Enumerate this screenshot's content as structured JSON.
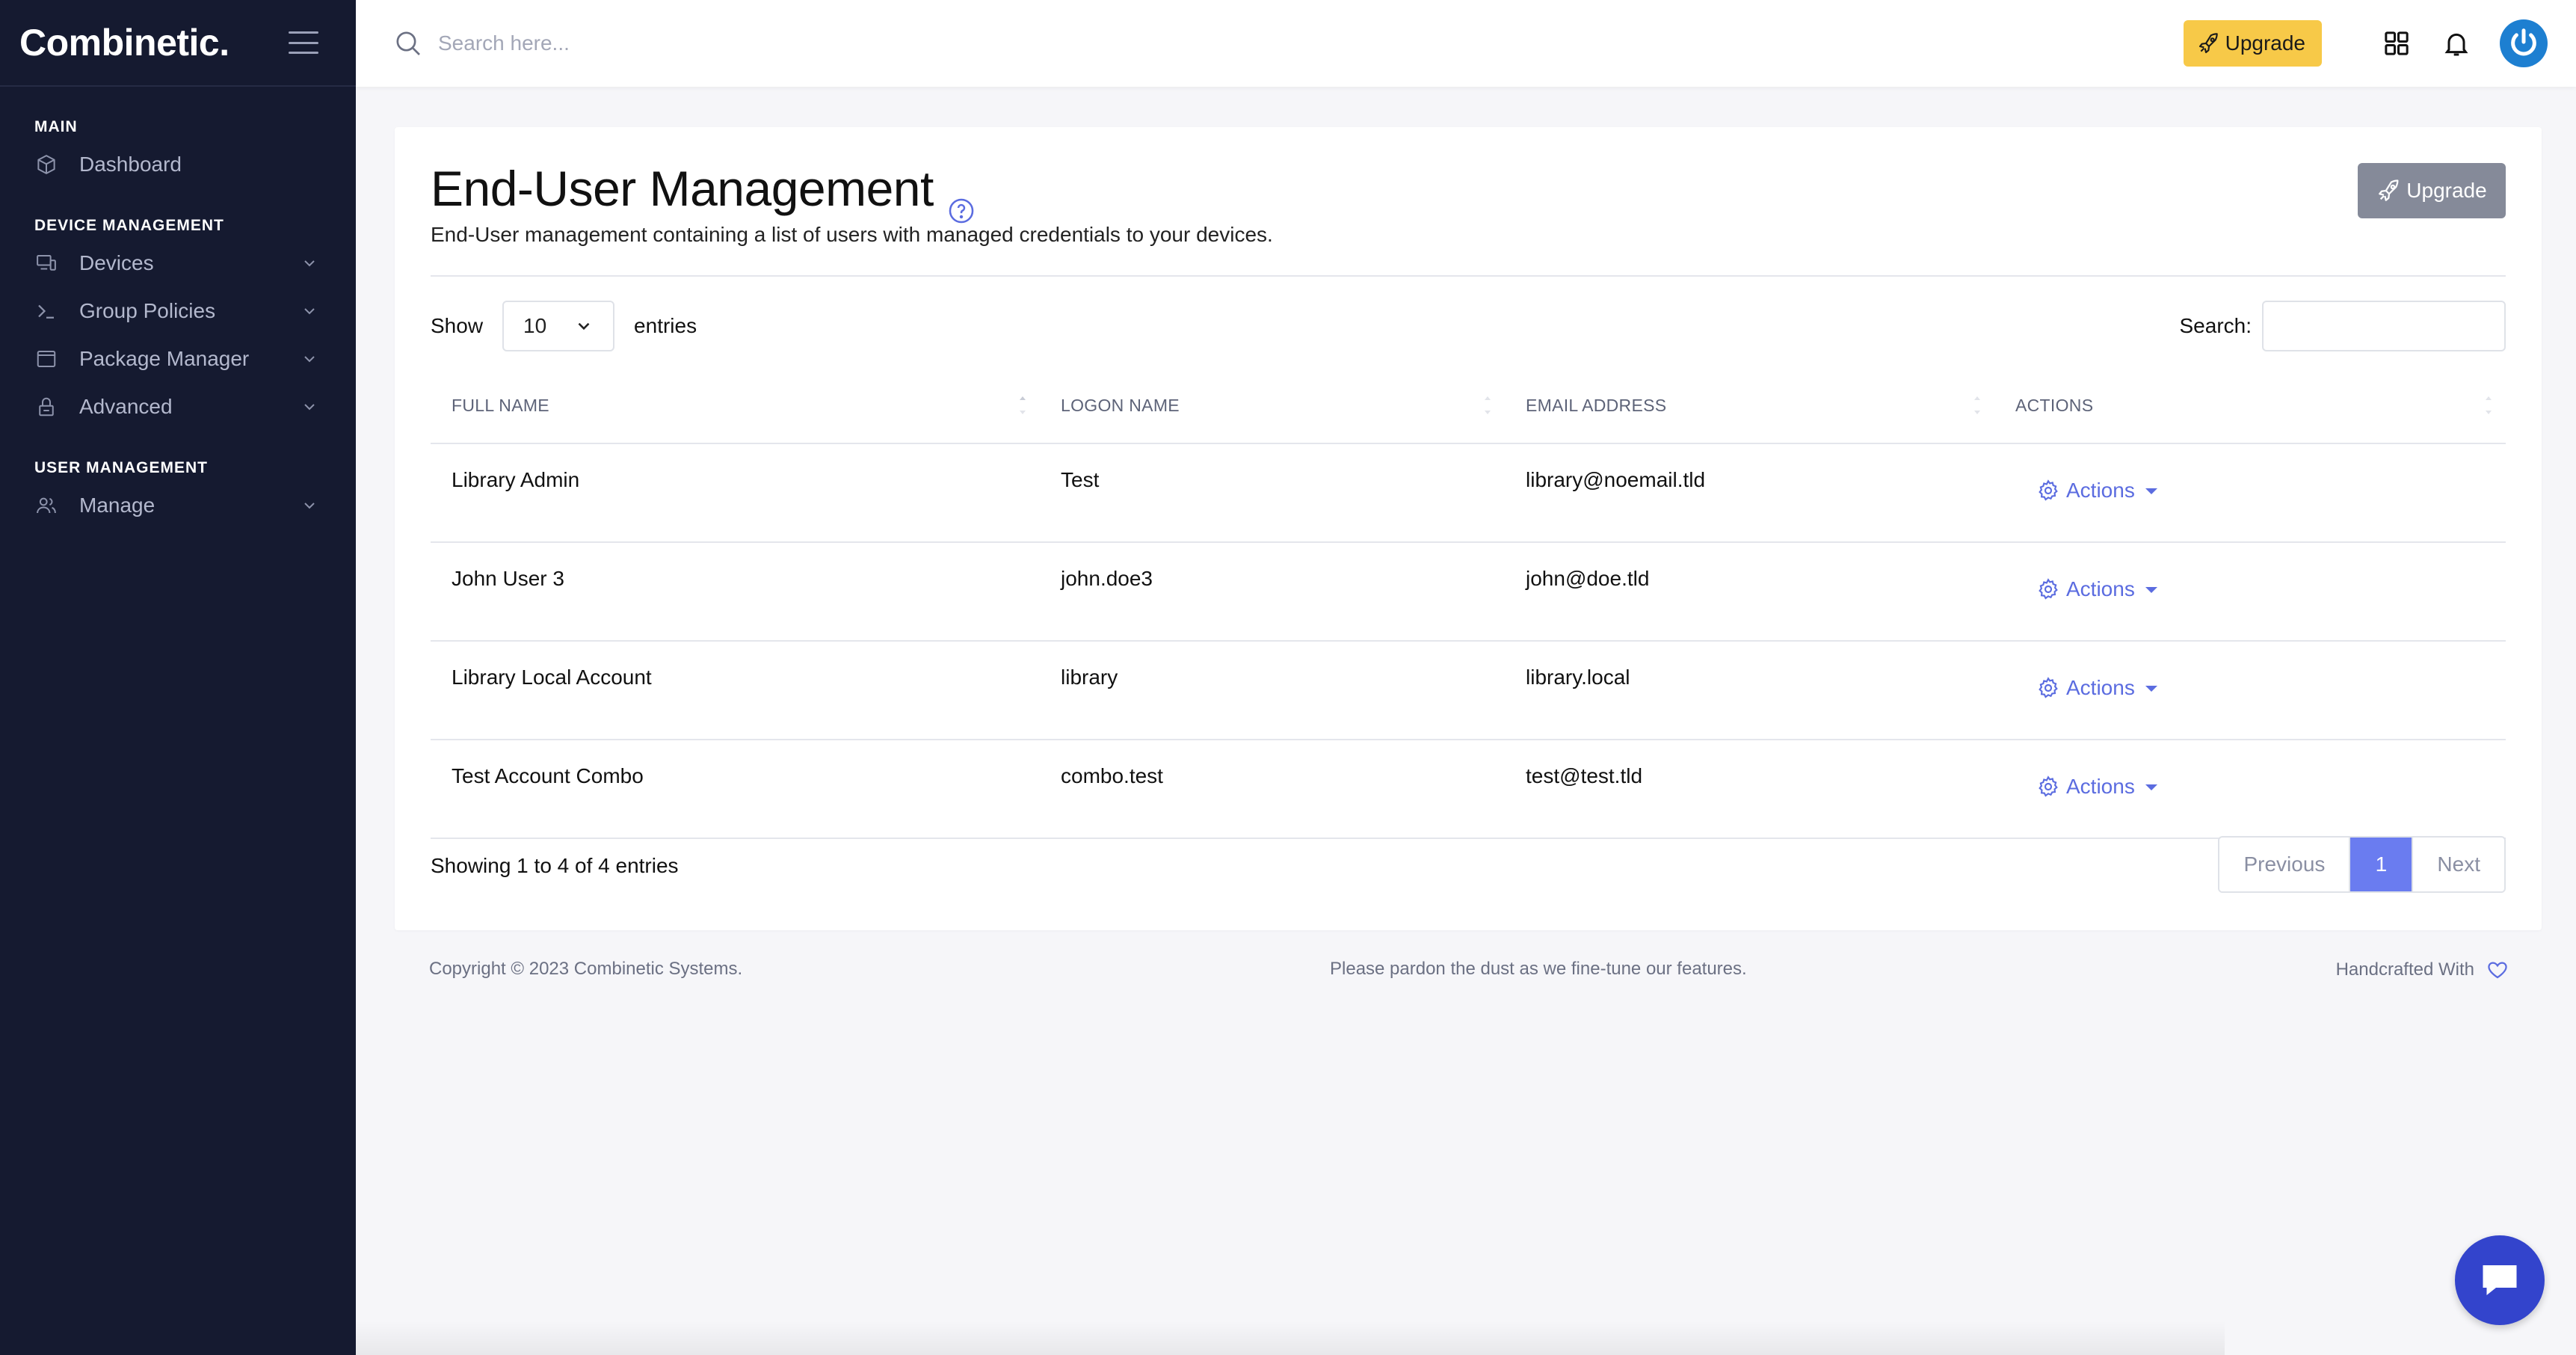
{
  "brand": {
    "name": "Combinetic."
  },
  "sidebar": {
    "sections": [
      {
        "title": "MAIN",
        "items": [
          {
            "label": "Dashboard",
            "icon": "cube-icon",
            "has_submenu": false
          }
        ]
      },
      {
        "title": "DEVICE MANAGEMENT",
        "items": [
          {
            "label": "Devices",
            "icon": "devices-icon",
            "has_submenu": true
          },
          {
            "label": "Group Policies",
            "icon": "terminal-icon",
            "has_submenu": true
          },
          {
            "label": "Package Manager",
            "icon": "window-icon",
            "has_submenu": true
          },
          {
            "label": "Advanced",
            "icon": "tools-icon",
            "has_submenu": true
          }
        ]
      },
      {
        "title": "USER MANAGEMENT",
        "items": [
          {
            "label": "Manage",
            "icon": "users-icon",
            "has_submenu": true
          }
        ]
      }
    ]
  },
  "topbar": {
    "search_placeholder": "Search here...",
    "upgrade_label": "Upgrade",
    "icons": [
      "apps-grid-icon",
      "bell-icon",
      "power-icon"
    ]
  },
  "page": {
    "title": "End-User Management",
    "subtitle": "End-User management containing a list of users with managed credentials to your devices.",
    "upgrade_label": "Upgrade"
  },
  "table_controls": {
    "show_label": "Show",
    "page_length": "10",
    "entries_label": "entries",
    "search_label": "Search:",
    "search_value": ""
  },
  "table": {
    "columns": [
      "FULL NAME",
      "LOGON NAME",
      "EMAIL ADDRESS",
      "ACTIONS"
    ],
    "rows": [
      {
        "full_name": "Library Admin",
        "logon_name": "Test",
        "email": "library@noemail.tld",
        "action_label": "Actions"
      },
      {
        "full_name": "John User 3",
        "logon_name": "john.doe3",
        "email": "john@doe.tld",
        "action_label": "Actions"
      },
      {
        "full_name": "Library Local Account",
        "logon_name": "library",
        "email": "library.local",
        "action_label": "Actions"
      },
      {
        "full_name": "Test Account Combo",
        "logon_name": "combo.test",
        "email": "test@test.tld",
        "action_label": "Actions"
      }
    ]
  },
  "pagination": {
    "info": "Showing 1 to 4 of 4 entries",
    "previous_label": "Previous",
    "current_page": "1",
    "next_label": "Next"
  },
  "footer": {
    "copyright": "Copyright © 2023 Combinetic Systems.",
    "notice": "Please pardon the dust as we fine-tune our features.",
    "handcrafted": "Handcrafted With"
  },
  "colors": {
    "sidebar_bg": "#151a30",
    "upgrade_yellow": "#f7c948",
    "accent_blue": "#5b6ce0",
    "pager_active": "#6a7cf0",
    "chat_blue": "#3344cc",
    "avatar_blue": "#1d7fd1"
  }
}
